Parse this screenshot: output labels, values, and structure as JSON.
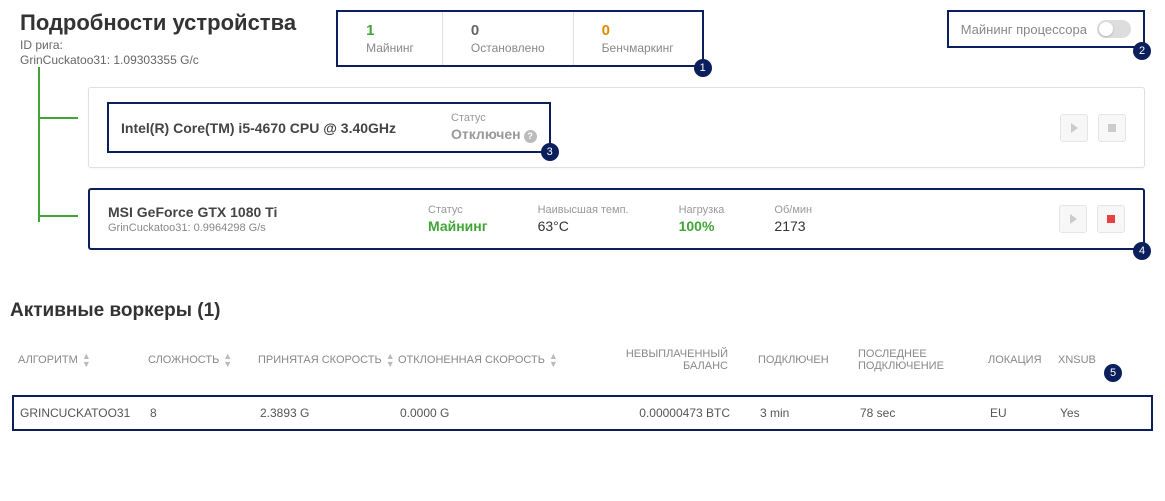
{
  "header": {
    "title": "Подробности устройства",
    "rig_id_label": "ID рига:",
    "hashrate": "GrinCuckatoo31: 1.09303355 G/c"
  },
  "stats": {
    "mining": {
      "value": "1",
      "label": "Майнинг"
    },
    "stopped": {
      "value": "0",
      "label": "Остановлено"
    },
    "bench": {
      "value": "0",
      "label": "Бенчмаркинг"
    }
  },
  "cpu_toggle_label": "Майнинг процессора",
  "badges": {
    "b1": "1",
    "b2": "2",
    "b3": "3",
    "b4": "4",
    "b5": "5"
  },
  "cpu_card": {
    "name": "Intel(R) Core(TM) i5-4670 CPU @ 3.40GHz",
    "status_label": "Статус",
    "status_value": "Отключен"
  },
  "gpu_card": {
    "name": "MSI GeForce GTX 1080 Ti",
    "sub": "GrinCuckatoo31: 0.9964298 G/s",
    "status_label": "Статус",
    "status_value": "Майнинг",
    "temp_label": "Наивысшая темп.",
    "temp_value": "63°C",
    "load_label": "Нагрузка",
    "load_value": "100%",
    "rpm_label": "Об/мин",
    "rpm_value": "2173"
  },
  "workers": {
    "title": "Активные воркеры (1)",
    "columns": {
      "algorithm": "АЛГОРИТМ",
      "difficulty": "СЛОЖНОСТЬ",
      "accepted": "ПРИНЯТАЯ СКОРОСТЬ",
      "rejected": "ОТКЛОНЕННАЯ СКОРОСТЬ",
      "balance": "НЕВЫПЛАЧЕННЫЙ БАЛАНС",
      "connected": "ПОДКЛЮЧЕН",
      "last": "ПОСЛЕДНЕЕ ПОДКЛЮЧЕНИЕ",
      "location": "ЛОКАЦИЯ",
      "xnsub": "XNSUB"
    },
    "row": {
      "algorithm": "GRINCUCKATOO31",
      "difficulty": "8",
      "accepted": "2.3893 G",
      "rejected": "0.0000 G",
      "balance": "0.00000473 BTC",
      "connected": "3 min",
      "last": "78 sec",
      "location": "EU",
      "xnsub": "Yes"
    }
  }
}
